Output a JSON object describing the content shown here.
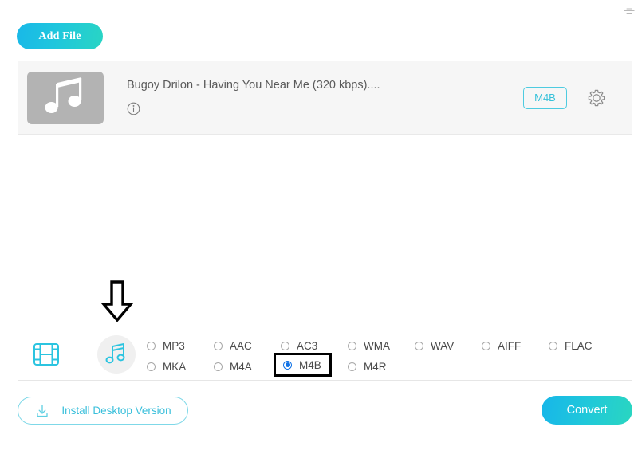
{
  "window": {
    "corner_mark": "⌯"
  },
  "toolbar": {
    "add_file_label": "Add File"
  },
  "file_list": [
    {
      "title": "Bugoy Drilon - Having You Near Me (320 kbps)....",
      "thumbnail_icon": "music-note-icon",
      "info_icon": "info-icon",
      "output_format": "M4B",
      "settings_icon": "gear-icon"
    }
  ],
  "annotation": {
    "arrow_icon": "down-arrow-icon"
  },
  "format_bar": {
    "type_tabs": [
      {
        "name": "video",
        "icon": "film-icon",
        "selected": false
      },
      {
        "name": "audio",
        "icon": "music-note-icon",
        "selected": true
      }
    ],
    "formats_row1": [
      {
        "label": "MP3",
        "selected": false,
        "highlighted": false
      },
      {
        "label": "AAC",
        "selected": false,
        "highlighted": false
      },
      {
        "label": "AC3",
        "selected": false,
        "highlighted": false
      },
      {
        "label": "WMA",
        "selected": false,
        "highlighted": false
      },
      {
        "label": "WAV",
        "selected": false,
        "highlighted": false
      },
      {
        "label": "AIFF",
        "selected": false,
        "highlighted": false
      },
      {
        "label": "FLAC",
        "selected": false,
        "highlighted": false
      }
    ],
    "formats_row2": [
      {
        "label": "MKA",
        "selected": false,
        "highlighted": false
      },
      {
        "label": "M4A",
        "selected": false,
        "highlighted": false
      },
      {
        "label": "M4B",
        "selected": true,
        "highlighted": true
      },
      {
        "label": "M4R",
        "selected": false,
        "highlighted": false
      }
    ]
  },
  "actions": {
    "install_label": "Install Desktop Version",
    "install_icon": "download-icon",
    "convert_label": "Convert"
  },
  "colors": {
    "accent_cyan": "#29c6dc",
    "radio_blue": "#1273e6",
    "highlight_black": "#000000",
    "row_background": "#f6f6f6"
  }
}
